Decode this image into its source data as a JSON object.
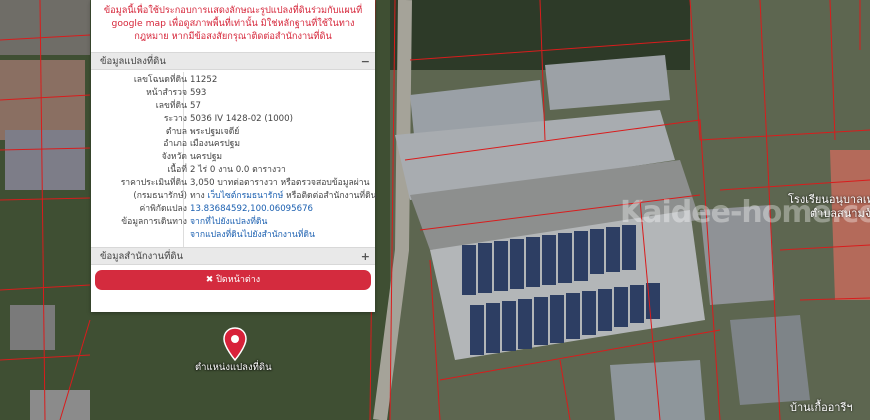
{
  "popup": {
    "notice": "ข้อมูลนี้เพื่อใช้ประกอบการแสดงลักษณะรูปแปลงที่ดินร่วมกับแผนที่ google map เพื่อดูสภาพพื้นที่เท่านั้น มิใช่หลักฐานที่ใช้ในทางกฎหมาย หากมีข้อสงสัยกรุณาติดต่อสำนักงานที่ดิน",
    "section_parcel": "ข้อมูลแปลงที่ดิน",
    "section_parcel_toggle": "−",
    "rows": [
      {
        "label": "เลขโฉนดที่ดิน",
        "value": "11252"
      },
      {
        "label": "หน้าสำรวจ",
        "value": "593"
      },
      {
        "label": "เลขที่ดิน",
        "value": "57"
      },
      {
        "label": "ระวาง",
        "value": "5036 IV 1428-02 (1000)"
      },
      {
        "label": "ตำบล",
        "value": "พระปฐมเจดีย์"
      },
      {
        "label": "อำเภอ",
        "value": "เมืองนครปฐม"
      },
      {
        "label": "จังหวัด",
        "value": "นครปฐม"
      },
      {
        "label": "เนื้อที่",
        "value": "2 ไร่ 0 งาน 0.0 ตารางวา"
      },
      {
        "label": "ราคาประเมินที่ดิน",
        "value": "3,050 บาทต่อตารางวา หรือตรวจสอบข้อมูลผ่าน"
      },
      {
        "label": "(กรมธนารักษ์)",
        "value_prefix": "ทาง",
        "value_link": "เว็บไซต์กรมธนารักษ์",
        "value_suffix": "หรือติดต่อสำนักงานที่ดิน"
      },
      {
        "label": "ค่าพิกัดแปลง",
        "value": "13.83684592,100.06095676"
      },
      {
        "label": "ข้อมูลการเดินทาง",
        "value": "จากที่ไปยังแปลงที่ดิน"
      },
      {
        "label": "",
        "value": "จากแปลงที่ดินไปยังสำนักงานที่ดิน"
      }
    ],
    "section_office": "ข้อมูลสำนักงานที่ดิน",
    "section_office_toggle": "+",
    "close_icon": "✖",
    "close_label": "ปิดหน้าต่าง"
  },
  "map": {
    "marker_icon": "map-pin-icon",
    "marker_label": "ตำแหน่งแปลงที่ดิน",
    "place_school": "โรงเรียนอนุบาลเทศบาล",
    "place_school2": "ตำบลสนามจันทร์",
    "place_bottom": "บ้านเกื้ออารีฯ",
    "watermark": "Kaidee-home.com"
  }
}
